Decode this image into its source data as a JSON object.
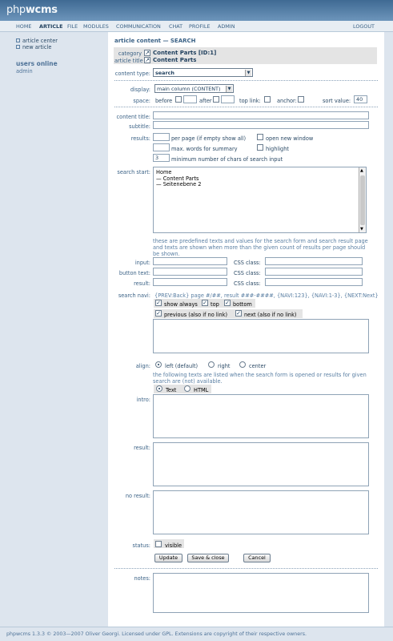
{
  "app": {
    "logo_light": "php",
    "logo_bold": "wcms"
  },
  "nav": {
    "items": [
      "HOME",
      "ARTICLE",
      "FILE",
      "MODULES",
      "COMMUNICATION",
      "CHAT",
      "PROFILE",
      "ADMIN"
    ],
    "logout": "LOGOUT"
  },
  "sidebar": {
    "links": [
      "article center",
      "new article"
    ],
    "users_title": "users online",
    "users": [
      "admin"
    ]
  },
  "header": {
    "title": "article content — SEARCH",
    "category_label": "category",
    "category_value": "Content Parts [ID:1]",
    "article_title_label": "article title",
    "article_title_value": "Content Parts"
  },
  "form": {
    "content_type_label": "content type:",
    "content_type_value": "search",
    "display_label": "display:",
    "display_value": "main column (CONTENT)",
    "space_label": "space:",
    "before": "before",
    "after": "after",
    "top_link": "top link:",
    "anchor": "anchor:",
    "sort_value_label": "sort value:",
    "sort_value": "40",
    "content_title_label": "content title:",
    "subtitle_label": "subtitle:",
    "results_label": "results:",
    "per_page": "per page (if empty show all)",
    "open_new_window": "open new window",
    "max_words": "max. words for summary",
    "highlight": "highlight",
    "min_chars_value": "3",
    "min_chars": "minimum number of chars of search input",
    "search_start_label": "search start:",
    "tree": [
      "Home",
      "— Content Parts",
      "— Seitenebene 2"
    ],
    "help_text": [
      "these are predefined texts and values for the search form and search result page",
      "and texts are shown when more than the given count of results per page should",
      "be shown."
    ],
    "input_label": "input:",
    "button_text_label": "button text:",
    "result_label": "result:",
    "css_class": "CSS class:",
    "search_navi_label": "search navi:",
    "navi_format": "{PREV:Back} page #/##, result ###-####, {NAVI:123}, {NAVI:1-3}, {NEXT:Next}",
    "show_always": "show always",
    "top": "top",
    "bottom": "bottom",
    "previous": "previous (also if no link)",
    "next": "next (also if no link)",
    "align_label": "align:",
    "align_left": "left (default)",
    "align_right": "right",
    "align_center": "center",
    "texts_help": [
      "the following texts are listed when the search form is opened or results for given",
      "search are (not) available."
    ],
    "text_mode": "Text",
    "html_mode": "HTML",
    "intro_label": "intro:",
    "result_text_label": "result:",
    "no_result_label": "no result:",
    "status_label": "status:",
    "visible": "visible",
    "update": "Update",
    "save_close": "Save & close",
    "cancel": "Cancel",
    "notes_label": "notes:"
  },
  "footer": {
    "text": "phpwcms 1.3.3 © 2003—2007 Oliver Georgi. Licensed under GPL. Extensions are copyright of their respective owners."
  }
}
